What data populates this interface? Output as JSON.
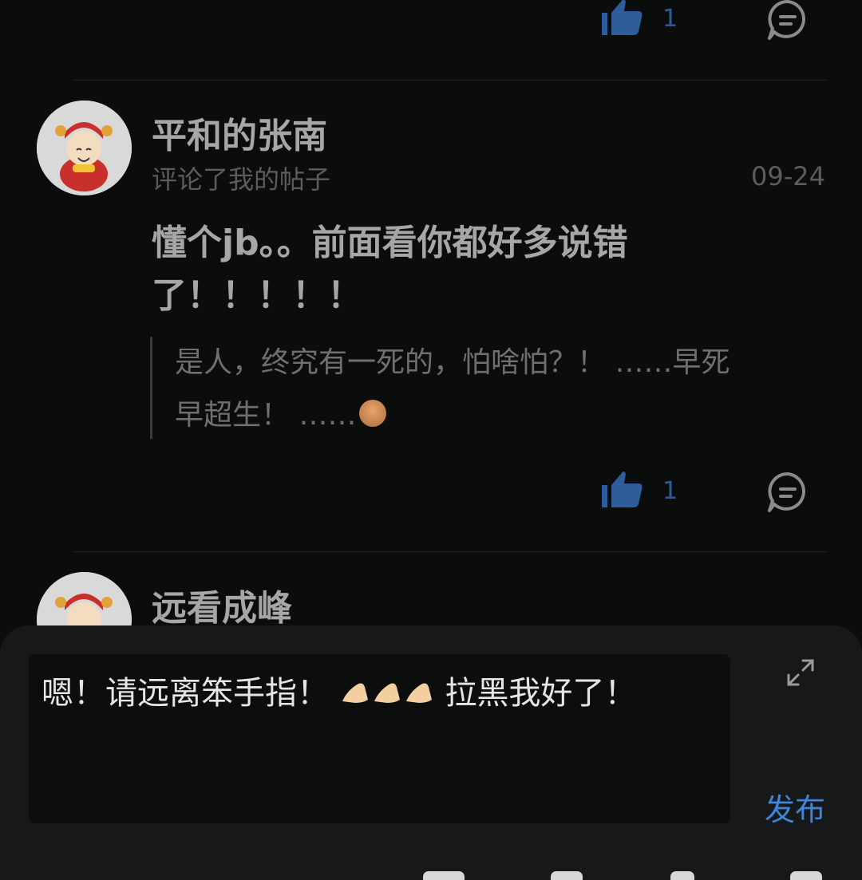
{
  "top_actions": {
    "like_count": "1",
    "like_icon": "thumbs-up-icon",
    "reply_icon": "comment-icon"
  },
  "comment": {
    "username": "平和的张南",
    "subtitle": "评论了我的帖子",
    "date": "09-24",
    "text_line1": "懂个jb。。前面看你都好多说错",
    "text_line2": "了！！！！！",
    "quote_line1": "是人，终究有一死的，怕啥怕？！ ……早死",
    "quote_line2": "早超生！ ……",
    "like_count": "1",
    "like_icon": "thumbs-up-icon",
    "reply_icon": "comment-icon"
  },
  "next_comment": {
    "username": "远看成峰"
  },
  "composer": {
    "text_before": "嗯！请远离笨手指！",
    "text_after": "拉黑我好了！",
    "expand_icon": "expand-icon",
    "publish_label": "发布"
  },
  "colors": {
    "accent": "#3d86d9",
    "like_blue": "#2f5c9a",
    "background": "#0b0c0c"
  }
}
